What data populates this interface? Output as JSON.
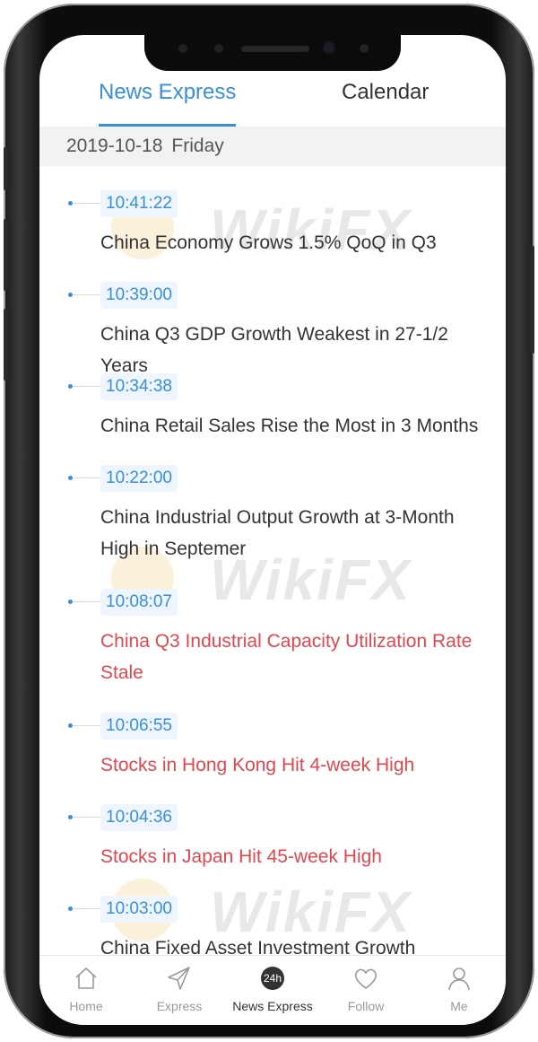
{
  "tabs": [
    {
      "label": "News Express",
      "active": true
    },
    {
      "label": "Calendar",
      "active": false
    }
  ],
  "date_bar": {
    "date": "2019-10-18",
    "weekday": "Friday"
  },
  "feed": [
    {
      "time": "10:41:22",
      "headline": "China Economy Grows 1.5% QoQ in Q3",
      "highlight": false
    },
    {
      "time": "10:39:00",
      "headline": "China Q3 GDP Growth Weakest in 27-1/2 Years",
      "highlight": false
    },
    {
      "time": "10:34:38",
      "headline": "China Retail Sales Rise the Most in 3 Months",
      "highlight": false
    },
    {
      "time": "10:22:00",
      "headline": "China Industrial Output Growth at 3-Month High in Septemer",
      "highlight": false
    },
    {
      "time": "10:08:07",
      "headline": "China Q3 Industrial Capacity Utilization Rate Stale",
      "highlight": true
    },
    {
      "time": "10:06:55",
      "headline": "Stocks in Hong Kong Hit 4-week High",
      "highlight": true
    },
    {
      "time": "10:04:36",
      "headline": "Stocks in Japan Hit 45-week High",
      "highlight": true
    },
    {
      "time": "10:03:00",
      "headline": "China Fixed Asset Investment  Growth Matches",
      "highlight": false
    }
  ],
  "watermark": "WikiFX",
  "nav": [
    {
      "label": "Home",
      "icon": "home-icon"
    },
    {
      "label": "Express",
      "icon": "paper-plane-icon"
    },
    {
      "label": "News Express",
      "icon": "24h-icon",
      "badge": "24h",
      "active": true
    },
    {
      "label": "Follow",
      "icon": "heart-icon"
    },
    {
      "label": "Me",
      "icon": "person-icon"
    }
  ],
  "colors": {
    "accent": "#3a8fd6",
    "highlight": "#e0474f",
    "text": "#333333"
  }
}
